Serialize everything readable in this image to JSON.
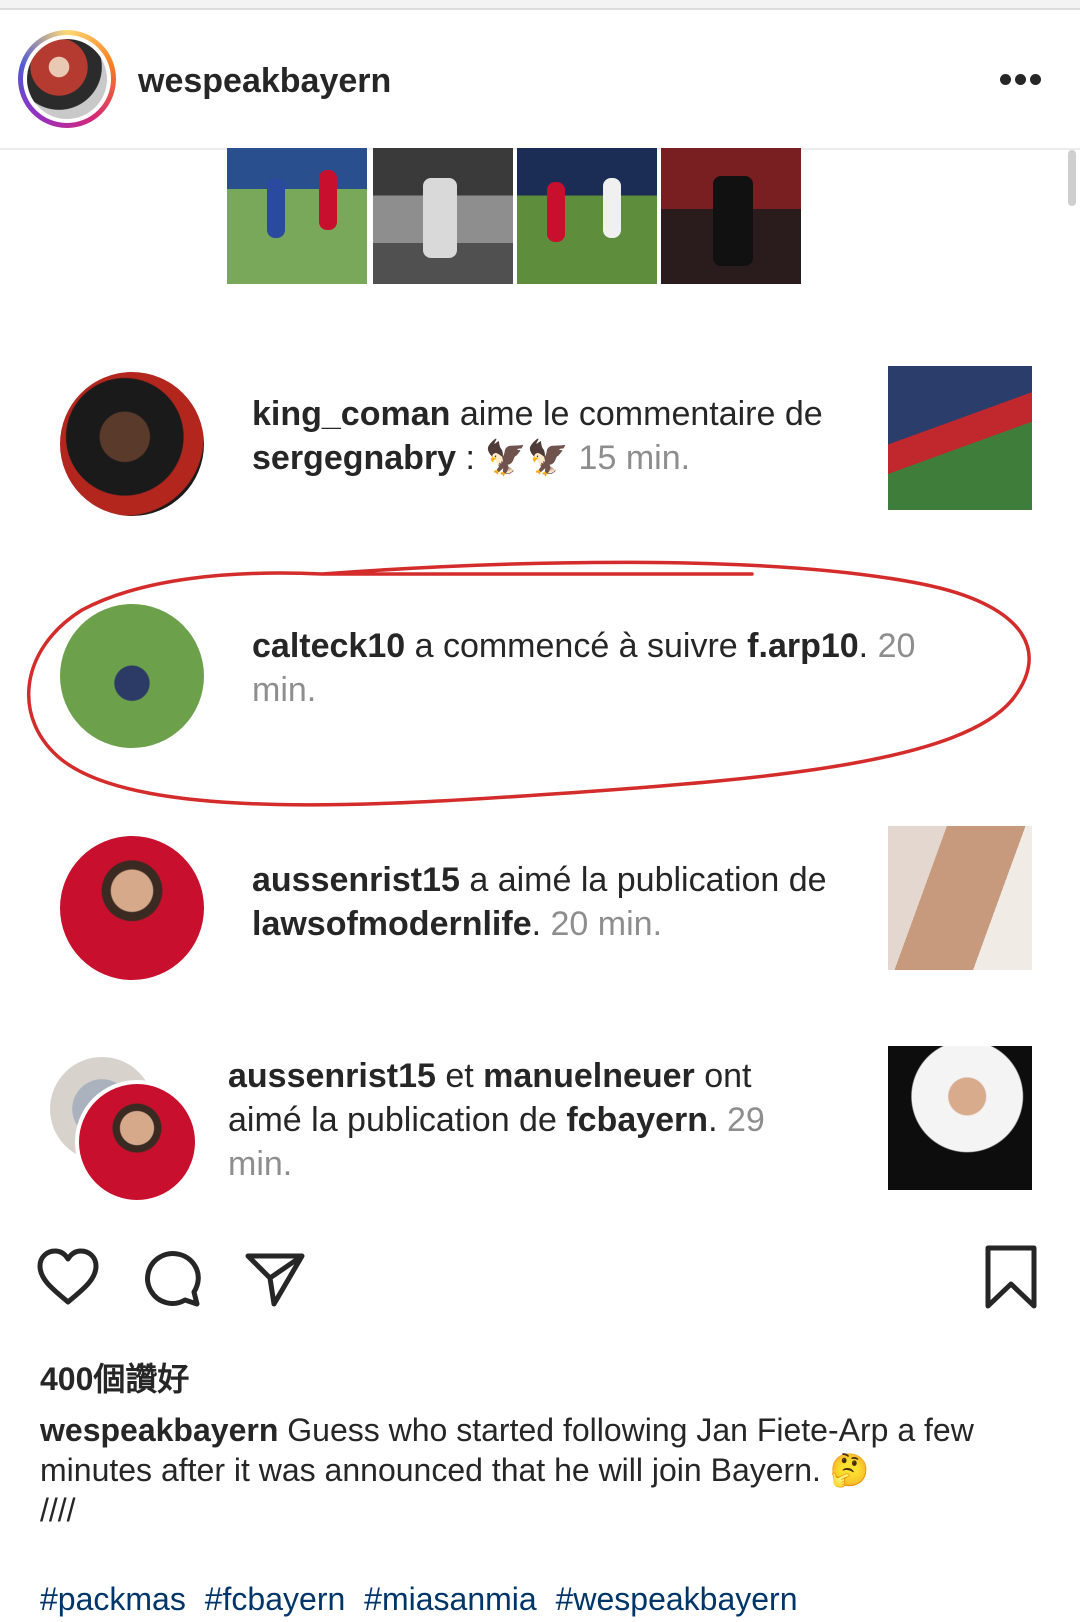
{
  "header": {
    "username": "wespeakbayern",
    "more_icon": "more-horizontal-icon"
  },
  "activity": [
    {
      "user": "king_coman",
      "action": " aime le commentaire de ",
      "target": "sergegnabry",
      "suffix": " : ",
      "emoji": "🦅🦅",
      "time": " 15 min."
    },
    {
      "user": "calteck10",
      "action": " a commencé à suivre ",
      "target": "f.arp10",
      "suffix": ". ",
      "time": "20 min.",
      "annotation": "red-hand-drawn-circle"
    },
    {
      "user": "aussenrist15",
      "action": " a aimé la publication de ",
      "target": "lawsofmodernlife",
      "suffix": ". ",
      "time": "20 min."
    },
    {
      "user": "aussenrist15",
      "connector": " et ",
      "user2": "manuelneuer",
      "action": " ont aimé la publication de ",
      "target": "fcbayern",
      "suffix": ". ",
      "time": "29 min."
    }
  ],
  "actions": {
    "like_icon": "heart-icon",
    "comment_icon": "comment-icon",
    "share_icon": "send-icon",
    "save_icon": "bookmark-icon"
  },
  "likes_text": "400個讚好",
  "caption": {
    "username": "wespeakbayern",
    "text": " Guess who started following Jan Fiete-Arp a few minutes after it was announced that he will join Bayern. 🤔",
    "line2": "////"
  },
  "hashtags": [
    "#packmas",
    "#fcbayern",
    "#miasanmia",
    "#wespeakbayern"
  ],
  "colors": {
    "text": "#262626",
    "time_gray": "#8e8e8e",
    "hashtag_blue": "#003569",
    "annotation_red": "#d42b2b"
  }
}
